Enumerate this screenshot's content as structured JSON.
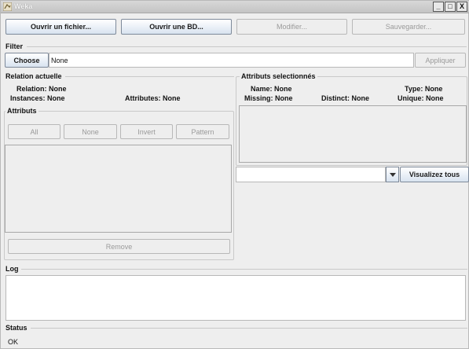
{
  "window": {
    "title": "Weka"
  },
  "title_buttons": {
    "minimize": "_",
    "maximize": "□",
    "close": "X"
  },
  "toolbar": {
    "open_file": "Ouvrir un fichier...",
    "open_db": "Ouvrir une BD...",
    "edit": "Modifier...",
    "save": "Sauvegarder..."
  },
  "filter": {
    "label": "Filter",
    "choose": "Choose",
    "value": "None",
    "apply": "Appliquer"
  },
  "current_relation": {
    "title": "Relation actuelle",
    "relation": "Relation: None",
    "instances": "Instances: None",
    "attributes": "Attributes: None"
  },
  "attributes_panel": {
    "title": "Attributs",
    "all": "All",
    "none": "None",
    "invert": "Invert",
    "pattern": "Pattern",
    "remove": "Remove"
  },
  "selected_attribute": {
    "title": "Attributs selectionnés",
    "name": "Name: None",
    "type": "Type: None",
    "missing": "Missing: None",
    "distinct": "Distinct: None",
    "unique": "Unique: None",
    "visualize_all": "Visualizez tous"
  },
  "log": {
    "label": "Log"
  },
  "status": {
    "label": "Status",
    "text": "OK"
  }
}
